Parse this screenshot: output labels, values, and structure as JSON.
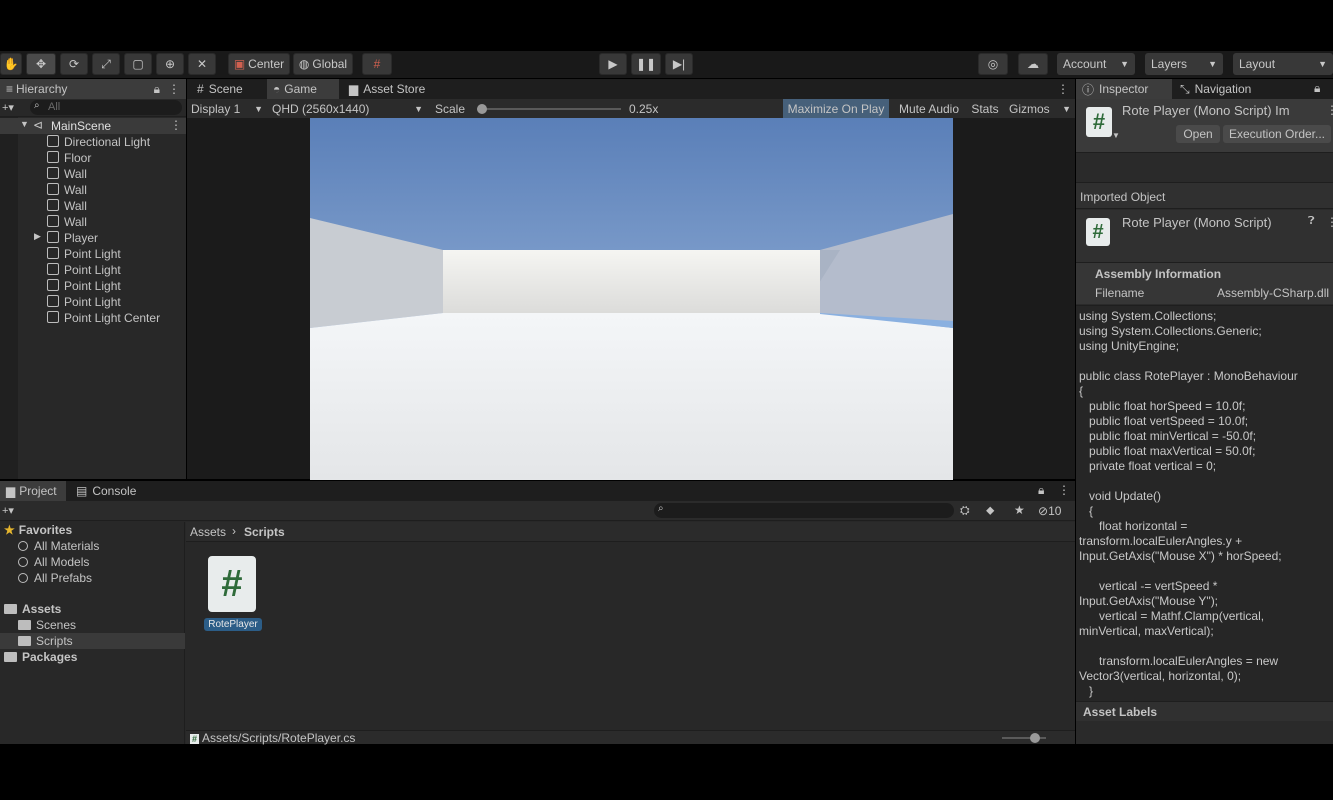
{
  "toolbar": {
    "pivot_label": "Center",
    "space_label": "Global",
    "account_label": "Account",
    "layers_label": "Layers",
    "layout_label": "Layout"
  },
  "hierarchy": {
    "tab_label": "Hierarchy",
    "search_placeholder": "All",
    "scene_name": "MainScene",
    "items": [
      "Directional Light",
      "Floor",
      "Wall",
      "Wall",
      "Wall",
      "Wall",
      "Player",
      "Point Light",
      "Point Light",
      "Point Light",
      "Point Light",
      "Point Light Center"
    ]
  },
  "viewport": {
    "tabs": [
      "Scene",
      "Game",
      "Asset Store"
    ],
    "display_label": "Display 1",
    "resolution_label": "QHD (2560x1440)",
    "scale_label": "Scale",
    "scale_value": "0.25x",
    "scale_fraction": 0.0,
    "maximize_label": "Maximize On Play",
    "mute_label": "Mute Audio",
    "stats_label": "Stats",
    "gizmos_label": "Gizmos"
  },
  "inspector": {
    "tabs": [
      "Inspector",
      "Navigation"
    ],
    "header_title": "Rote Player (Mono Script) Im",
    "open_label": "Open",
    "exec_order_label": "Execution Order...",
    "imported_object_label": "Imported Object",
    "script_title": "Rote Player (Mono Script)",
    "assembly_heading": "Assembly Information",
    "filename_label": "Filename",
    "filename_value": "Assembly-CSharp.dll",
    "code": "using System.Collections;\nusing System.Collections.Generic;\nusing UnityEngine;\n\npublic class RotePlayer : MonoBehaviour\n{\n   public float horSpeed = 10.0f;\n   public float vertSpeed = 10.0f;\n   public float minVertical = -50.0f;\n   public float maxVertical = 50.0f;\n   private float vertical = 0;\n\n   void Update()\n   {\n      float horizontal =\ntransform.localEulerAngles.y +\nInput.GetAxis(\"Mouse X\") * horSpeed;\n\n      vertical -= vertSpeed *\nInput.GetAxis(\"Mouse Y\");\n      vertical = Mathf.Clamp(vertical,\nminVertical, maxVertical);\n\n      transform.localEulerAngles = new\nVector3(vertical, horizontal, 0);\n   }",
    "asset_labels": "Asset Labels"
  },
  "project": {
    "tabs": [
      "Project",
      "Console"
    ],
    "hidden_count": "10",
    "favorites_label": "Favorites",
    "favorites": [
      "All Materials",
      "All Models",
      "All Prefabs"
    ],
    "assets_label": "Assets",
    "asset_folders": [
      "Scenes",
      "Scripts"
    ],
    "packages_label": "Packages",
    "breadcrumb_root": "Assets",
    "breadcrumb_current": "Scripts",
    "file_name": "RotePlayer",
    "status_path": "Assets/Scripts/RotePlayer.cs"
  },
  "colors": {
    "accent_selection": "#2c5d87",
    "script_green": "#2f6b3a"
  }
}
